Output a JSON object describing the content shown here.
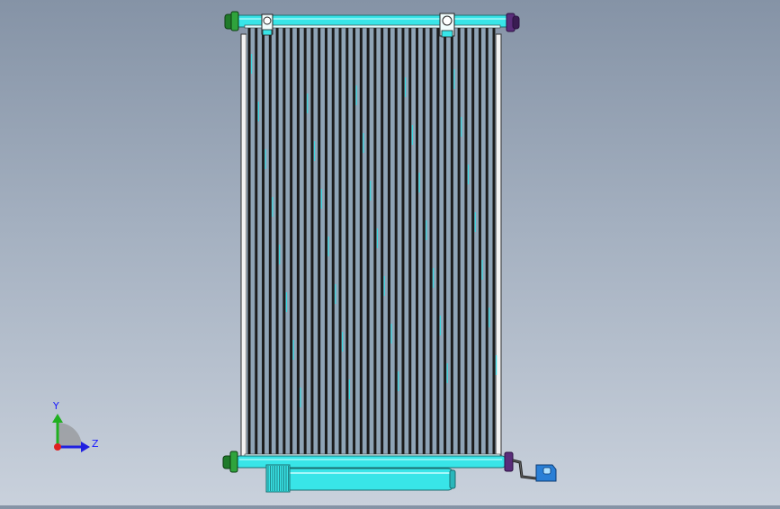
{
  "viewport": {
    "background_top": "#8593a6",
    "background_bottom": "#c9d1dc"
  },
  "model": {
    "part_colors": {
      "tank": "#38e5e8",
      "tank_edge": "#1a6d70",
      "fin": "#1c1c1c",
      "fin_gap": "#8fa4b6",
      "fin_highlight": "#3ad8e0",
      "fitting_green": "#1f7a2a",
      "fitting_purple": "#5a2d7a",
      "bracket_blue": "#2a7fd6",
      "frame": "#f2f2f2"
    },
    "tube_count": 36
  },
  "triad": {
    "y_label": "Y",
    "z_label": "Z",
    "x_axis_color": "#e02020",
    "y_axis_color": "#20b020",
    "z_axis_color": "#2020e0"
  }
}
